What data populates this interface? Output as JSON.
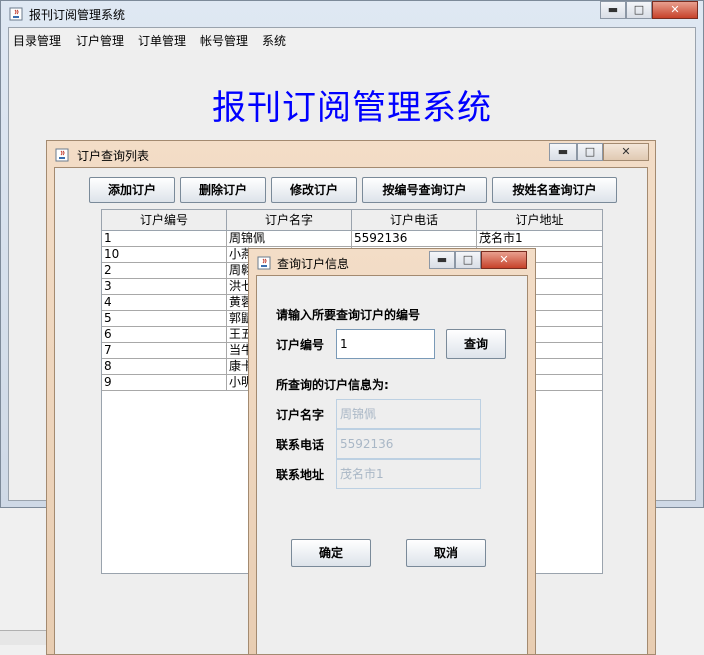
{
  "main_window": {
    "title": "报刊订阅管理系统",
    "menu": [
      "目录管理",
      "订户管理",
      "订单管理",
      "帐号管理",
      "系统"
    ],
    "heading": "报刊订阅管理系统",
    "controls": {
      "minimize": "▬",
      "maximize": "□",
      "close": "✕"
    }
  },
  "list_window": {
    "title": "订户查询列表",
    "controls": {
      "minimize": "▬",
      "maximize": "□",
      "close": "✕"
    },
    "buttons": [
      "添加订户",
      "删除订户",
      "修改订户",
      "按编号查询订户",
      "按姓名查询订户"
    ],
    "columns": [
      "订户编号",
      "订户名字",
      "订户电话",
      "订户地址"
    ],
    "rows": [
      [
        "1",
        "周锦佩",
        "5592136",
        "茂名市1"
      ],
      [
        "10",
        "小燕",
        "",
        ""
      ],
      [
        "2",
        "周翱",
        "",
        ""
      ],
      [
        "3",
        "洪七",
        "",
        ""
      ],
      [
        "4",
        "黄蓉",
        "",
        ""
      ],
      [
        "5",
        "郭鼱",
        "",
        ""
      ],
      [
        "6",
        "王五",
        "",
        ""
      ],
      [
        "7",
        "当牛",
        "",
        ""
      ],
      [
        "8",
        "康卡",
        "",
        ""
      ],
      [
        "9",
        "小明",
        "",
        ""
      ]
    ]
  },
  "dialog": {
    "title": "查询订户信息",
    "controls": {
      "minimize": "▬",
      "maximize": "□",
      "close": "✕"
    },
    "prompt": "请输入所要查询订户的编号",
    "id_label": "订户编号",
    "id_value": "1",
    "query_button": "查询",
    "result_heading": "所查询的订户信息为:",
    "fields": [
      {
        "label": "订户名字",
        "value": "周锦佩"
      },
      {
        "label": "联系电话",
        "value": "5592136"
      },
      {
        "label": "联系地址",
        "value": "茂名市1"
      }
    ],
    "ok_button": "确定",
    "cancel_button": "取消"
  },
  "colors": {
    "heading": "#0000ff",
    "frame_blue": "#dfe8f3",
    "frame_orange": "#f3ddc7",
    "disabled_text": "#a9b7c6"
  },
  "icons": {
    "window_icon": "java-cup-icon"
  }
}
